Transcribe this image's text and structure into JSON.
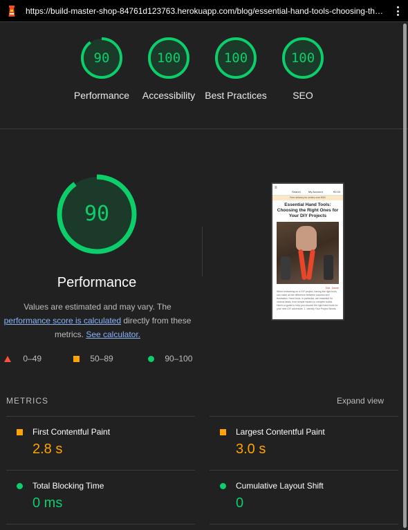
{
  "browser": {
    "url": "https://build-master-shop-84761d123763.herokuapp.com/blog/essential-hand-tools-choosing-the..."
  },
  "scores": [
    {
      "label": "Performance",
      "value": "90",
      "fraction": 0.9
    },
    {
      "label": "Accessibility",
      "value": "100",
      "fraction": 1.0
    },
    {
      "label": "Best Practices",
      "value": "100",
      "fraction": 1.0
    },
    {
      "label": "SEO",
      "value": "100",
      "fraction": 1.0
    }
  ],
  "performance": {
    "score": "90",
    "fraction": 0.9,
    "title": "Performance",
    "desc_prefix": "Values are estimated and may vary. The",
    "score_link": "performance score is calculated",
    "desc_mid": "directly from these metrics.",
    "calc_link": "See calculator."
  },
  "legend": [
    {
      "shape": "triangle",
      "color": "#ff4e42",
      "range": "0–49"
    },
    {
      "shape": "square",
      "color": "#ffa400",
      "range": "50–89"
    },
    {
      "shape": "circle",
      "color": "#0cce6b",
      "range": "90–100"
    }
  ],
  "screenshot": {
    "nav_search": "Search",
    "nav_account": "My Account",
    "nav_cart": "€0.00",
    "promo": "Free delivery for orders over €50!",
    "title": "Essential Hand Tools: Choosing the Right Ones for Your DIY Projects",
    "edit": "Edit",
    "delete": "Delete",
    "body": "When embarking on a DIY project, having the right tools can make all the difference between success and frustration. Hand tools, in particular, are essential for various tasks, from simple repairs to complex builds. Here's a guide to help you choose the right hand tools for your next DIY adventure. 1. Identify Your Project Needs"
  },
  "metrics": {
    "heading": "METRICS",
    "expand_label": "Expand view",
    "items": [
      {
        "label": "First Contentful Paint",
        "value": "2.8 s",
        "status": "average"
      },
      {
        "label": "Largest Contentful Paint",
        "value": "3.0 s",
        "status": "average"
      },
      {
        "label": "Total Blocking Time",
        "value": "0 ms",
        "status": "pass"
      },
      {
        "label": "Cumulative Layout Shift",
        "value": "0",
        "status": "pass"
      }
    ]
  },
  "colors": {
    "pass": "#0cce6b",
    "average": "#ffa400",
    "fail": "#ff4e42",
    "link": "#8ab4f8"
  }
}
